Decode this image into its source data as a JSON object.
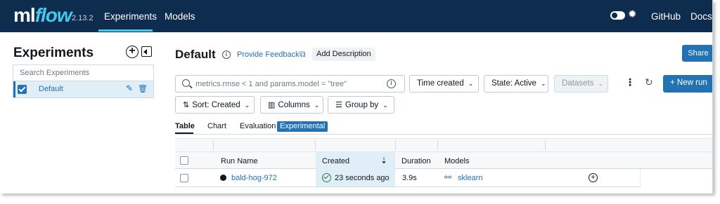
{
  "app": {
    "logo_ml": "ml",
    "logo_flow": "flow",
    "version": "2.13.2",
    "nav": {
      "experiments": "Experiments",
      "models": "Models",
      "github": "GitHub",
      "docs": "Docs"
    },
    "accent_color": "#43c9ed",
    "nav_background": "#0e2c4e"
  },
  "sidebar": {
    "title": "Experiments",
    "search_placeholder": "Search Experiments",
    "items": [
      {
        "label": "Default",
        "selected": true
      }
    ]
  },
  "main": {
    "title": "Default",
    "provide_feedback": "Provide Feedback",
    "add_description": "Add Description",
    "share": "Share",
    "search_placeholder": "metrics.rmse < 1 and params.model = \"tree\"",
    "filters": {
      "time_created": "Time created",
      "state": "State: Active",
      "datasets": "Datasets",
      "new_run": "New run",
      "sort": "Sort: Created",
      "columns": "Columns",
      "group_by": "Group by"
    },
    "tabs": {
      "table": "Table",
      "chart": "Chart",
      "evaluation": "Evaluation",
      "experimental": "Experimental"
    },
    "table": {
      "headers": {
        "run_name": "Run Name",
        "created": "Created",
        "duration": "Duration",
        "models": "Models"
      },
      "rows": [
        {
          "run_name": "bald-hog-972",
          "created": "23 seconds ago",
          "duration": "3.9s",
          "model": "sklearn"
        }
      ]
    },
    "primary_color": "#2272b4"
  }
}
